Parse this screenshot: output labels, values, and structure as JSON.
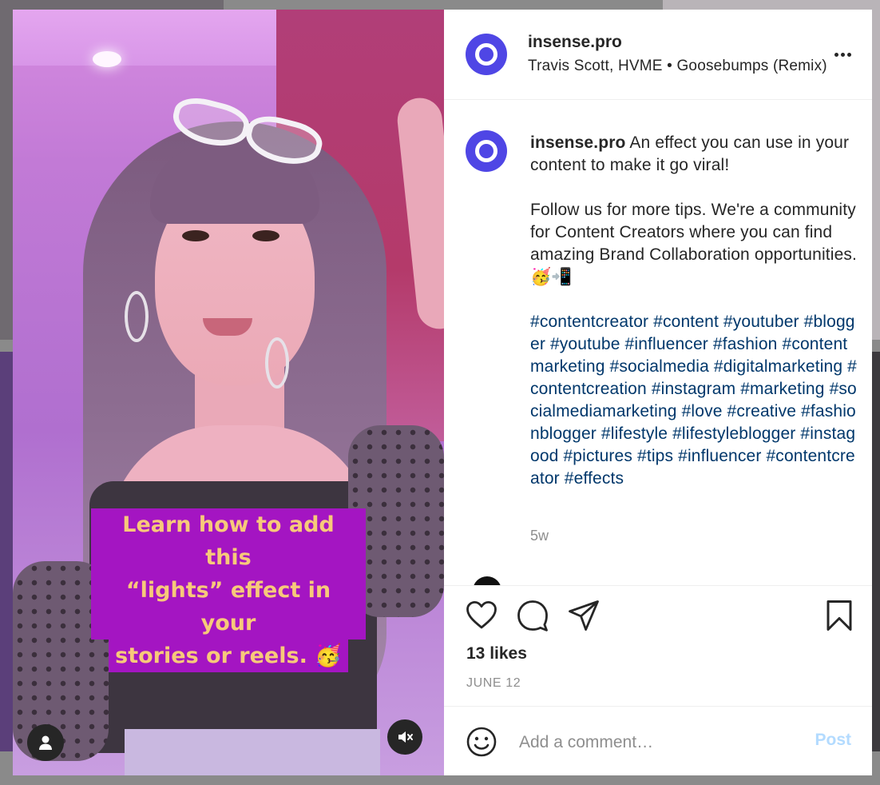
{
  "post": {
    "username": "insense.pro",
    "audio": "Travis Scott, HVME • Goosebumps (Remix)",
    "media_caption": [
      "Learn how to add this",
      "“lights” effect in your",
      "stories or reels. 🥳"
    ],
    "caption_text": "An effect you can use in your content to make it go viral!",
    "caption_para2": "Follow us for more tips. We're a community for Content Creators where you can find amazing Brand Collaboration opportunities. 🥳📲",
    "hashtags": "#contentcreator  #content #youtuber #blogger #youtube #influencer #fashion #contentmarketing #socialmedia #digitalmarketing #contentcreation #instagram #marketing #socialmediamarketing #love #creative #fashionblogger #lifestyle #lifestyleblogger #instagood #pictures #tips #influencer #contentcreator #effects",
    "time_ago": "5w",
    "likes": "13 likes",
    "date": "JUNE 12"
  },
  "comment_box": {
    "placeholder": "Add a comment…",
    "post_label": "Post"
  },
  "icons": {
    "like": "heart-icon",
    "comment": "comment-icon",
    "share": "send-icon",
    "save": "bookmark-icon",
    "emoji": "emoji-icon",
    "more": "more-icon",
    "user": "user-icon",
    "mute": "mute-icon"
  },
  "colors": {
    "brand_avatar": "#4f46e5",
    "hashtag": "#00376b",
    "post_disabled": "#b3dbff",
    "caption_bg": "#a415c2",
    "caption_text": "#f7c97a"
  }
}
